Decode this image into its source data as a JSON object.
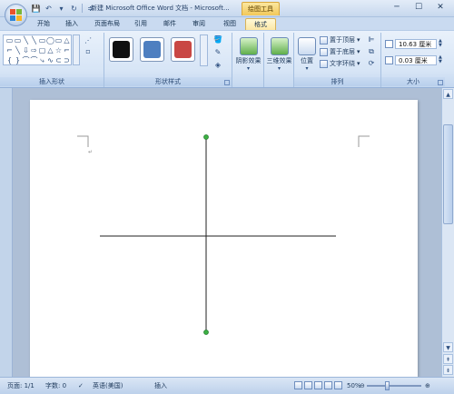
{
  "titlebar": {
    "title": "新建 Microsoft Office Word 文档 - Microsoft...",
    "context_tab": "绘图工具",
    "qat": [
      "💾",
      "↶",
      "▾",
      "↻",
      "≑"
    ],
    "controls": [
      "─",
      "☐",
      "✕"
    ]
  },
  "tabs": [
    "开始",
    "插入",
    "页面布局",
    "引用",
    "邮件",
    "审阅",
    "视图",
    "格式"
  ],
  "active_tab": "格式",
  "ribbon": {
    "insert_shapes": {
      "label": "插入形状",
      "shapes": [
        "▭",
        "▭",
        "╲",
        "╲",
        "▭",
        "◯",
        "▭",
        "△",
        "⌐",
        "╲",
        "⇩",
        "⇨",
        "▢",
        "△",
        "☆",
        "⌐",
        "{",
        "}",
        "⌒",
        "⌒",
        "⤷",
        "∿",
        "⊂",
        "⊃"
      ]
    },
    "shape_styles": {
      "label": "形状样式",
      "swatches": [
        "#111111",
        "#4e7fc0",
        "#c94744"
      ]
    },
    "shadow_effects": {
      "label": "阴影效果"
    },
    "three_d_effects": {
      "label": "三维效果"
    },
    "arrange": {
      "label": "排列",
      "position": "位置",
      "bring_to_front": "置于顶层",
      "send_to_back": "置于底层",
      "text_wrapping": "文字环绕"
    },
    "size": {
      "label": "大小",
      "height": "10.63 厘米",
      "width": "0.03 厘米"
    }
  },
  "statusbar": {
    "page": "页面: 1/1",
    "words": "字数: 0",
    "language": "英语(美国)",
    "mode": "插入",
    "zoom": "50%",
    "zoom_level": 0.5
  },
  "colors": {
    "line": "#222222",
    "handle": "#3cb043",
    "ribbon": "#d7e5f6",
    "context_tab": "#f2c85a"
  }
}
